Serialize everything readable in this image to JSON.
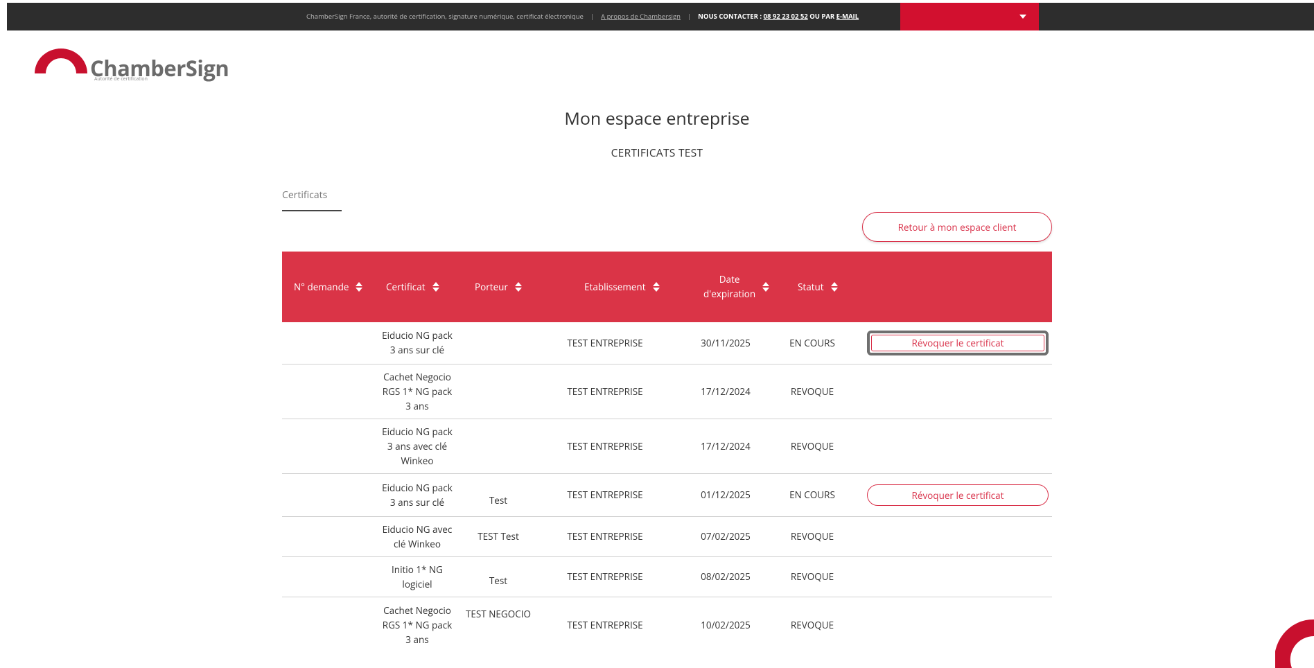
{
  "topbar": {
    "tagline": "ChamberSign France, autorité de certification, signature numérique, certificat électronique",
    "about_link": "A propos de Chambersign",
    "contact_label": "NOUS CONTACTER : ",
    "phone": "08 92 23 02 52",
    "or_label": " OU PAR ",
    "email_link": "E-MAIL"
  },
  "logo": {
    "name": "ChamberSign",
    "subtitle": "Autorité de certification"
  },
  "page": {
    "title": "Mon espace entreprise",
    "subtitle": "CERTIFICATS TEST"
  },
  "tabs": [
    {
      "label": "Certificats"
    }
  ],
  "back_button": "Retour à mon espace client",
  "table": {
    "headers": {
      "numero": "N° demande",
      "certificat": "Certificat",
      "porteur": "Porteur",
      "etablissement": "Etablissement",
      "date_line1": "Date",
      "date_line2": "d'expiration",
      "statut": "Statut"
    },
    "rows": [
      {
        "certificat": [
          "Eiducio NG pack",
          "3 ans sur clé"
        ],
        "porteur": "",
        "etablissement": "TEST ENTREPRISE",
        "date": "30/11/2025",
        "statut": "EN COURS",
        "action": "Révoquer le certificat"
      },
      {
        "certificat": [
          "Cachet Negocio",
          "RGS 1* NG pack",
          "3 ans"
        ],
        "porteur": "",
        "etablissement": "TEST ENTREPRISE",
        "date": "17/12/2024",
        "statut": "REVOQUE",
        "action": ""
      },
      {
        "certificat": [
          "Eiducio NG pack",
          "3 ans avec clé",
          "Winkeo"
        ],
        "porteur": "",
        "etablissement": "TEST ENTREPRISE",
        "date": "17/12/2024",
        "statut": "REVOQUE",
        "action": ""
      },
      {
        "certificat": [
          "Eiducio NG pack",
          "3 ans sur clé"
        ],
        "porteur": "Test",
        "etablissement": "TEST ENTREPRISE",
        "date": "01/12/2025",
        "statut": "EN COURS",
        "action": "Révoquer le certificat"
      },
      {
        "certificat": [
          "Eiducio NG avec",
          "clé Winkeo"
        ],
        "porteur": "TEST Test",
        "etablissement": "TEST ENTREPRISE",
        "date": "07/02/2025",
        "statut": "REVOQUE",
        "action": ""
      },
      {
        "certificat": [
          "Initio 1* NG",
          "logiciel"
        ],
        "porteur": "Test",
        "etablissement": "TEST ENTREPRISE",
        "date": "08/02/2025",
        "statut": "REVOQUE",
        "action": ""
      },
      {
        "certificat": [
          "Cachet Negocio",
          "RGS 1* NG pack",
          "3 ans"
        ],
        "porteur": "TEST NEGOCIO",
        "etablissement": "TEST ENTREPRISE",
        "date": "10/02/2025",
        "statut": "REVOQUE",
        "action": ""
      }
    ]
  },
  "colors": {
    "brand_red": "#da3447",
    "topbar_dark": "#2d2d2d",
    "topbar_red": "#d2102f"
  }
}
